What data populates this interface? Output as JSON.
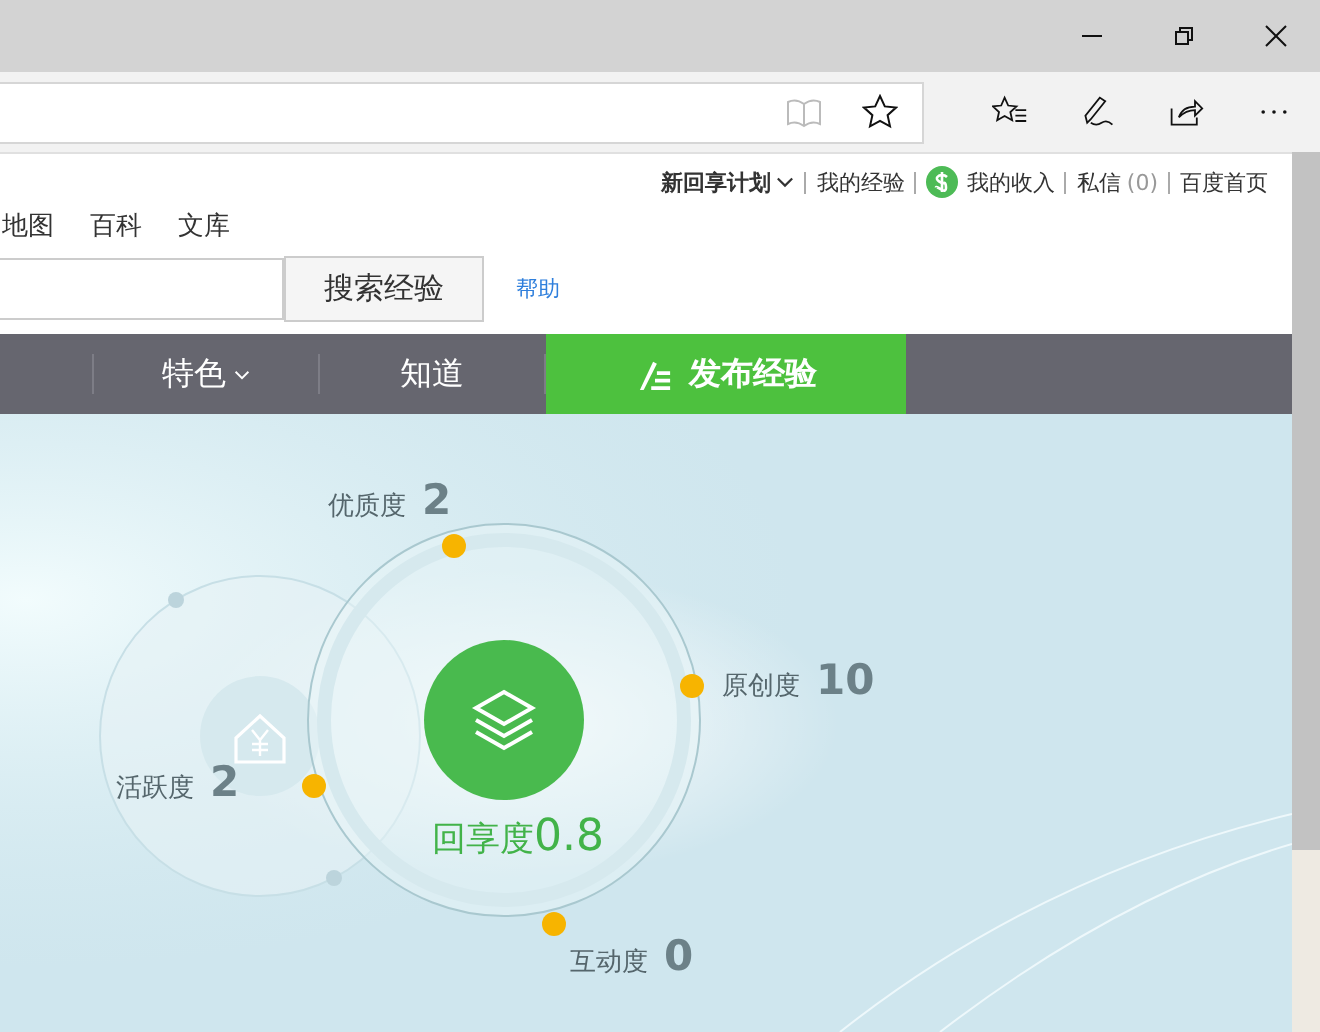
{
  "user_links": [
    {
      "label": "新回享计划",
      "kind": "menu"
    },
    {
      "label": "我的经验",
      "kind": "link"
    },
    {
      "label": "我的收入",
      "kind": "income"
    },
    {
      "label": "私信",
      "count": "(0)",
      "kind": "link"
    },
    {
      "label": "百度首页",
      "kind": "link"
    }
  ],
  "product_links": [
    "地图",
    "百科",
    "文库"
  ],
  "search": {
    "button": "搜索经验",
    "help": "帮助"
  },
  "nav": [
    {
      "label": "特色",
      "kind": "menu"
    },
    {
      "label": "知道",
      "kind": "plain"
    },
    {
      "label": "发布经验",
      "kind": "publish"
    }
  ],
  "metrics": [
    {
      "label": "优质度",
      "value": "2"
    },
    {
      "label": "原创度",
      "value": "10"
    },
    {
      "label": "活跃度",
      "value": "2"
    },
    {
      "label": "互动度",
      "value": "0"
    }
  ],
  "score": {
    "label": "回享度",
    "value": "0.8"
  }
}
